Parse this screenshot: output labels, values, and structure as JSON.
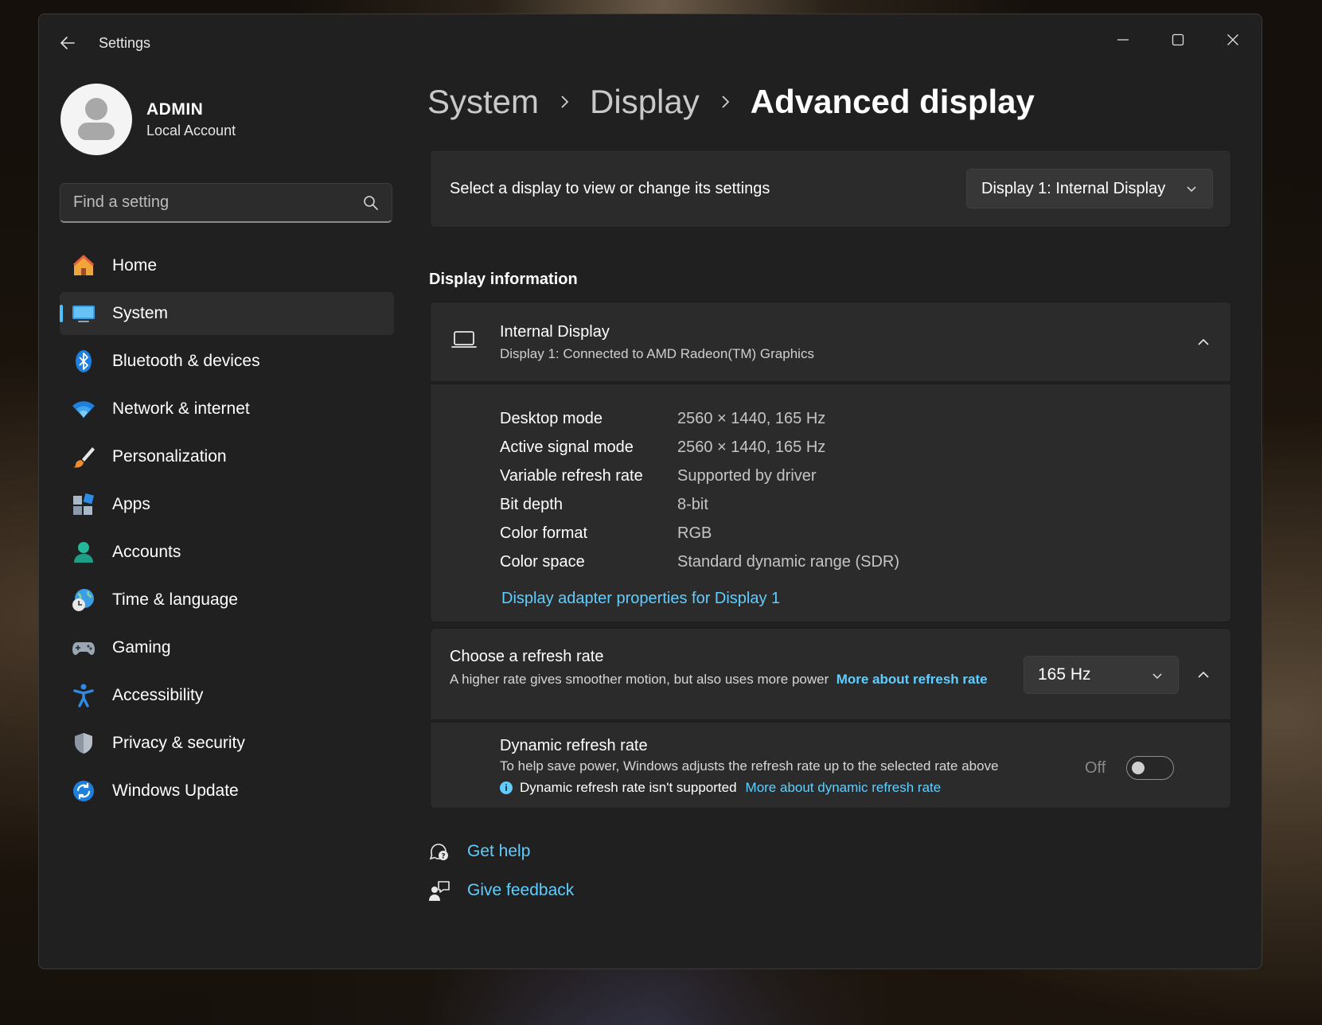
{
  "window": {
    "app_title": "Settings"
  },
  "profile": {
    "name": "ADMIN",
    "account_type": "Local Account"
  },
  "search": {
    "placeholder": "Find a setting"
  },
  "sidebar": {
    "items": [
      {
        "label": "Home",
        "icon": "home-icon"
      },
      {
        "label": "System",
        "icon": "system-display-icon",
        "active": true
      },
      {
        "label": "Bluetooth & devices",
        "icon": "bluetooth-icon"
      },
      {
        "label": "Network & internet",
        "icon": "wifi-icon"
      },
      {
        "label": "Personalization",
        "icon": "brush-icon"
      },
      {
        "label": "Apps",
        "icon": "apps-icon"
      },
      {
        "label": "Accounts",
        "icon": "accounts-icon"
      },
      {
        "label": "Time & language",
        "icon": "globe-clock-icon"
      },
      {
        "label": "Gaming",
        "icon": "gamepad-icon"
      },
      {
        "label": "Accessibility",
        "icon": "accessibility-icon"
      },
      {
        "label": "Privacy & security",
        "icon": "shield-icon"
      },
      {
        "label": "Windows Update",
        "icon": "update-icon"
      }
    ]
  },
  "breadcrumb": {
    "items": [
      "System",
      "Display"
    ],
    "current": "Advanced display"
  },
  "display_select": {
    "label": "Select a display to view or change its settings",
    "selected": "Display 1: Internal Display"
  },
  "display_info": {
    "heading": "Display information",
    "title": "Internal Display",
    "subtitle": "Display 1: Connected to AMD Radeon(TM) Graphics",
    "rows": [
      {
        "key": "Desktop mode",
        "value": "2560 × 1440, 165 Hz"
      },
      {
        "key": "Active signal mode",
        "value": "2560 × 1440, 165 Hz"
      },
      {
        "key": "Variable refresh rate",
        "value": "Supported by driver"
      },
      {
        "key": "Bit depth",
        "value": "8-bit"
      },
      {
        "key": "Color format",
        "value": "RGB"
      },
      {
        "key": "Color space",
        "value": "Standard dynamic range (SDR)"
      }
    ],
    "adapter_link": "Display adapter properties for Display 1"
  },
  "refresh_rate": {
    "title": "Choose a refresh rate",
    "description": "A higher rate gives smoother motion, but also uses more power",
    "more_link": "More about refresh rate",
    "selected": "165 Hz"
  },
  "dynamic_refresh": {
    "title": "Dynamic refresh rate",
    "description": "To help save power, Windows adjusts the refresh rate up to the selected rate above",
    "note": "Dynamic refresh rate isn't supported",
    "more_link": "More about dynamic refresh rate",
    "toggle_state": "Off"
  },
  "help": {
    "get_help": "Get help",
    "give_feedback": "Give feedback"
  },
  "colors": {
    "accent": "#4cc2ff",
    "link": "#60cdff",
    "window_bg": "#202020",
    "card_bg": "#2b2b2b"
  }
}
